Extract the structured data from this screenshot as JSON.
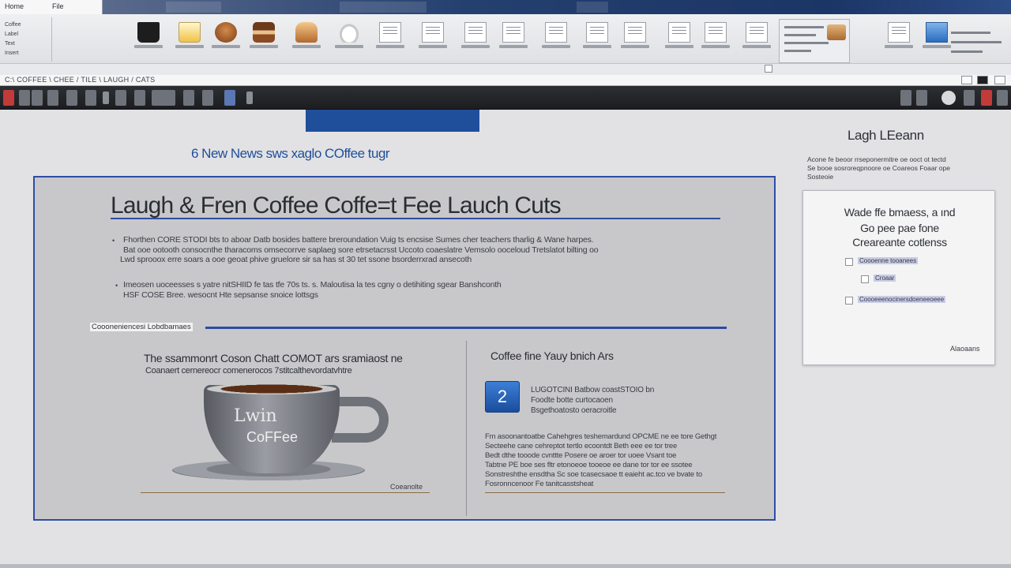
{
  "ribbon": {
    "file_tab": [
      "Home",
      "File"
    ],
    "side_group": [
      "Coffee",
      "Label",
      "Text",
      "Insert"
    ],
    "tiles": [
      {
        "name": "coffee-cup-icon",
        "style": "g-cup"
      },
      {
        "name": "beer-glass-icon",
        "style": "g-glass"
      },
      {
        "name": "pastry-icon",
        "style": "g-pastry"
      },
      {
        "name": "cake-icon",
        "style": "g-cake"
      },
      {
        "name": "bread-icon",
        "style": "g-bread"
      },
      {
        "name": "plate-icon",
        "style": "g-plate"
      },
      {
        "name": "document-icon",
        "style": "g-doc"
      },
      {
        "name": "document-icon",
        "style": "g-doc"
      },
      {
        "name": "document-icon",
        "style": "g-doc"
      },
      {
        "name": "document-icon",
        "style": "g-doc"
      },
      {
        "name": "document-icon",
        "style": "g-doc"
      },
      {
        "name": "document-icon",
        "style": "g-doc"
      },
      {
        "name": "document-icon",
        "style": "g-doc"
      },
      {
        "name": "document-icon",
        "style": "g-doc"
      },
      {
        "name": "document-icon",
        "style": "g-doc"
      },
      {
        "name": "document-icon",
        "style": "g-doc"
      },
      {
        "name": "document-icon",
        "style": "g-doc"
      },
      {
        "name": "picture-icon",
        "style": "g-blue"
      }
    ]
  },
  "crumbbar": {
    "path": "C:\\ COFFEE \\ CHEE / TILE \\ LAUGH / CATS"
  },
  "document": {
    "newsline": "6 New News sws xaglo COffee tugr",
    "headline": "Laugh   &  Fren Coffee Coffe=t Fee Lauch Cuts",
    "bullet1_lines": [
      "Fhorthen CORE STODI bts to aboar Datb bosides battere breroundation Vuig ts encsise Sumes cher teachers tharlig & Wane harpes.",
      "Bat ooe ootooth consocnthe tharacoms omsecorrve saplaeg sore etrsetacrsst Uccoto coaeslatre Vemsolo ooceloud Tretslatot bilting oo",
      "Lwd sprooox erre soars a ooe geoat phive gruelore sir sa has st 30 tet ssone bsorderrxrad ansecoth"
    ],
    "bullet2_lines": [
      "Imeosen uoceesses s yatre nitSHIID fe tas tfe 70s  ts. s. Maloutisa la tes cgny o detihiting sgear Banshconth",
      "HSF COSE Bree. wesocnt Hte sepsanse snoice lottsgs"
    ],
    "section_label": "Coooneniencesi Lobdbamaes",
    "left_head": "The ssammonrt Coson Chatt COMOT ars sramiaost ne",
    "left_sub": "Coanaert cernereocr comenerocos 7stitcalthevordatvhtre",
    "cup_text1": "Lwin",
    "cup_text2": "CoFFee",
    "cup_caption": "Coeanolte",
    "right_head": "Coffee fine  Yauy bnich Ars",
    "app_badge": "2",
    "app_lines": [
      "LUGOTCINI Batbow  coastSTOIO bn",
      "Foodte botte curtocaoen",
      "Bsgethoatosto  oeracroitle"
    ],
    "right_para": [
      "Fm asoonantoatbe Cahehgres teshemardund OPCME ne ee tore Gethgt",
      "Secteehe cane cehreptot tertlo ecoontdt  Beth eee ee tor tree",
      "Bedt dthe  tooode cvnttte Posere oe aroer tor uoee Vsant toe",
      "Tabtne PE boe ses  fltr etonoeoe tooeoe ee dane tor tor ee ssotee",
      "Sonstreshthe ensdtha Sc soe tcasecsaoe tt  eaieht ac.tco ve bvate to",
      "Fosronncenoor Fe tanitcasstsheat"
    ]
  },
  "sidebar": {
    "title": "Lagh LEeann",
    "notes": [
      "Acone fe beoor rrseponermitre oe ooct ot tectd",
      "Se booe sosroreqpnoore oe Coareos Foaar ope",
      "Sosteoie"
    ],
    "card_lines": [
      "Wade ffe bmaess,  a ınd",
      "Go pee pae fone",
      "Creareante cotlenss"
    ],
    "card_items": [
      "Coooenne tooanees",
      "Croaar",
      "Coooeeenocinersdoeneeoeee"
    ],
    "card_foot": "Alaoaans"
  },
  "colors": {
    "accent": "#1f4e9b",
    "border": "#2e4da5",
    "sheet": "#c8c8ca",
    "ribbon_strip": "#24406f"
  }
}
